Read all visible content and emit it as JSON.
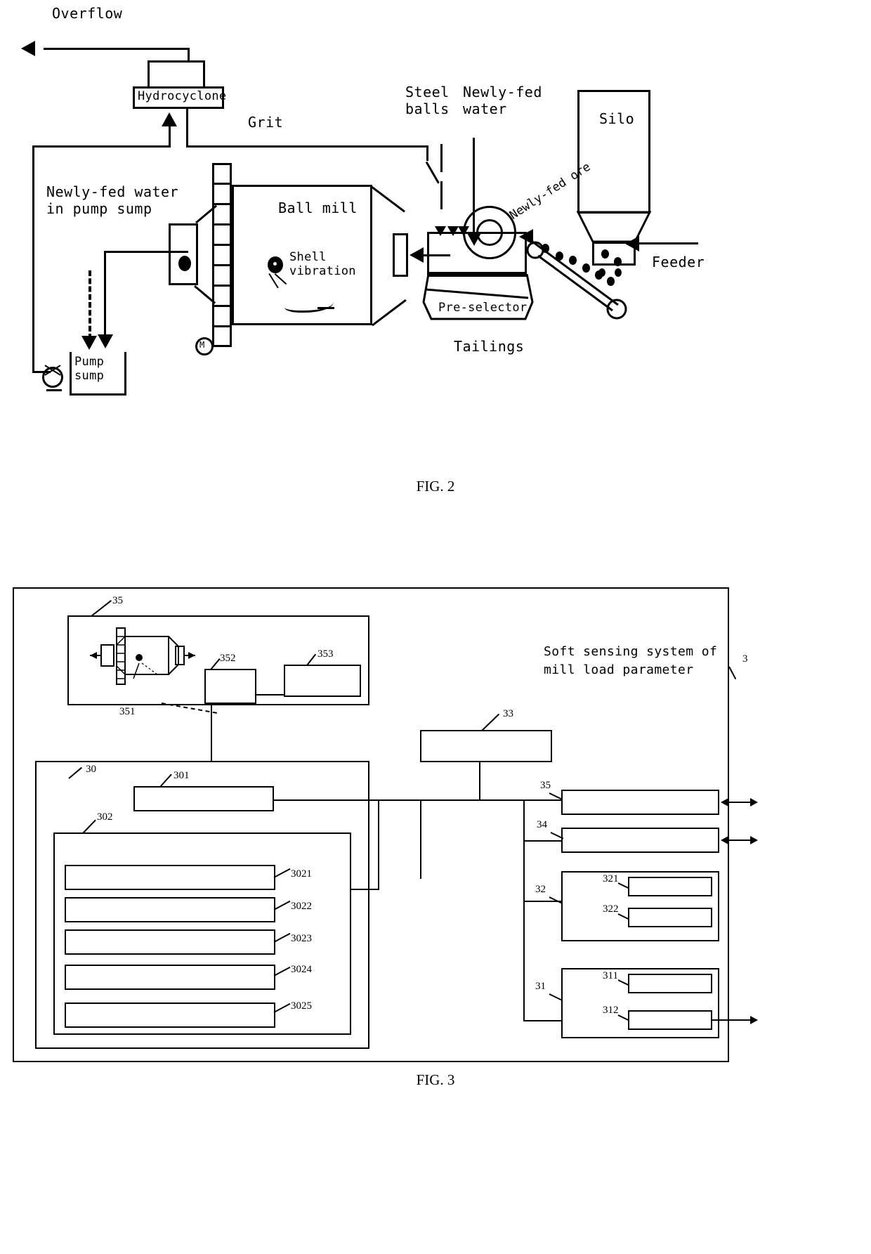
{
  "figure2": {
    "caption": "FIG. 2",
    "labels": {
      "overflow": "Overflow",
      "hydrocyclone": "Hydrocyclone",
      "grit": "Grit",
      "steel_balls": "Steel\nballs",
      "newly_fed_water": "Newly-fed\nwater",
      "silo": "Silo",
      "newly_fed_water_pump_sump": "Newly-fed water\nin pump sump",
      "ball_mill": "Ball mill",
      "shell_vibration": "Shell\nvibration",
      "newly_fed_ore": "Newly-fed ore",
      "feeder": "Feeder",
      "pre_selector": "Pre-selector",
      "tailings": "Tailings",
      "pump_sump": "Pump\nsump",
      "motor": "M"
    }
  },
  "figure3": {
    "caption": "FIG. 3",
    "title": "Soft sensing system of\nmill load parameter",
    "refs": {
      "system": "3",
      "sensor_group": "35",
      "mill_shell": "351",
      "conditioner": "352",
      "acquisition": "353",
      "model_block": "30",
      "unit_301": "301",
      "unit_302": "302",
      "unit_3021": "3021",
      "unit_3022": "3022",
      "unit_3023": "3023",
      "unit_3024": "3024",
      "unit_3025": "3025",
      "unit_33": "33",
      "unit_35r": "35",
      "unit_34": "34",
      "unit_32": "32",
      "unit_321": "321",
      "unit_322": "322",
      "unit_31": "31",
      "unit_311": "311",
      "unit_312": "312"
    }
  }
}
